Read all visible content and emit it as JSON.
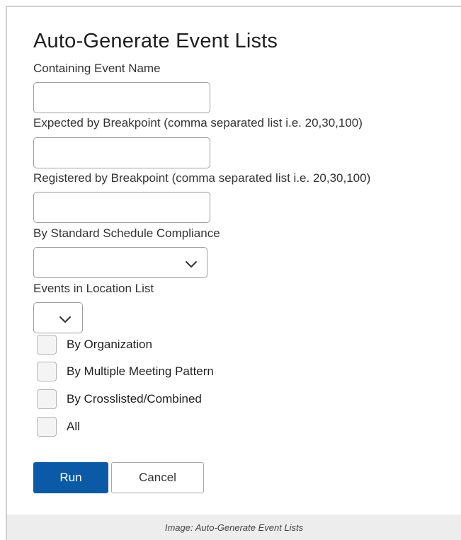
{
  "form": {
    "title": "Auto-Generate Event Lists",
    "event_name": {
      "label": "Containing Event Name",
      "value": ""
    },
    "expected_breakpoint": {
      "label": "Expected by Breakpoint (comma separated list i.e. 20,30,100)",
      "value": ""
    },
    "registered_breakpoint": {
      "label": "Registered by Breakpoint (comma separated list i.e. 20,30,100)",
      "value": ""
    },
    "schedule_compliance": {
      "label": "By Standard Schedule Compliance",
      "selected": ""
    },
    "location_list": {
      "label": "Events in Location List",
      "selected": ""
    },
    "checkboxes": [
      {
        "label": "By Organization",
        "checked": false
      },
      {
        "label": "By Multiple Meeting Pattern",
        "checked": false
      },
      {
        "label": "By Crosslisted/Combined",
        "checked": false
      },
      {
        "label": "All",
        "checked": false
      }
    ]
  },
  "buttons": {
    "run": "Run",
    "cancel": "Cancel"
  },
  "caption": "Image: Auto-Generate Event Lists",
  "colors": {
    "primary": "#0b5aa8",
    "caption_bg": "#ededed",
    "border": "#9e9e9e"
  },
  "icons": {
    "dropdown": "chevron-down-icon"
  }
}
